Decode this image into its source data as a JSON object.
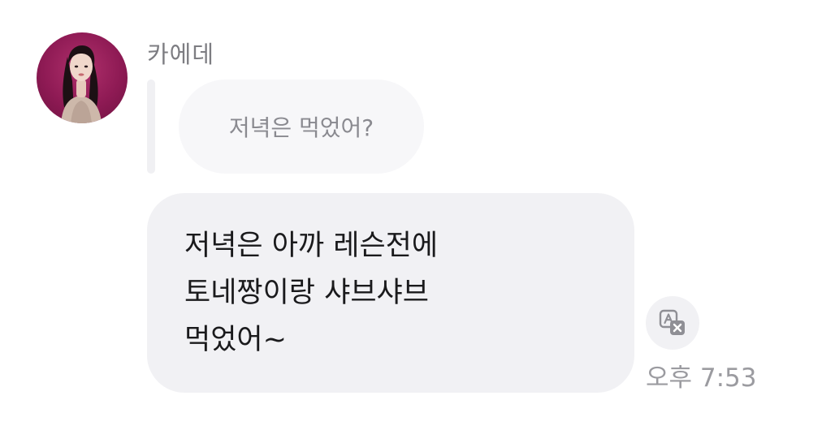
{
  "sender": {
    "name": "카에데",
    "avatar": "profile-photo"
  },
  "reply": {
    "quoted_text": "저녁은 먹었어?"
  },
  "message": {
    "lines": [
      "저녁은 아까 레슨전에",
      "토네짱이랑 샤브샤브",
      "먹었어~"
    ],
    "timestamp": "오후 7:53"
  },
  "actions": {
    "translate_icon": "translate-icon"
  },
  "colors": {
    "bubble": "#f1f1f4",
    "reply_bubble": "#f7f7f9",
    "avatar_bg": "#8e1a54",
    "text": "#1a1a1c",
    "muted": "#9b9ba0"
  }
}
